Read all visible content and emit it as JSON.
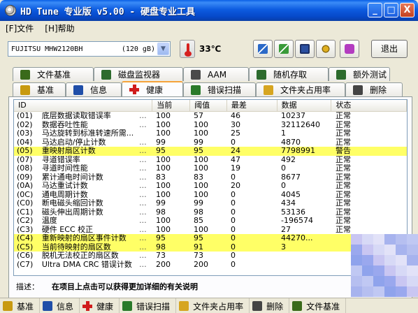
{
  "window": {
    "title": "HD Tune 专业版 v5.00 - 硬盘专业工具",
    "buttons": [
      "_",
      "□",
      "X"
    ]
  },
  "menu": [
    "[F]文件",
    "[H]帮助"
  ],
  "toolbar": {
    "drive_name": "FUJITSU MHW2120BH",
    "drive_size": "(120 gB)",
    "temperature": "33℃",
    "exit_label": "退出"
  },
  "tabs_top": [
    {
      "label": "文件基准",
      "icon": "file-benchmark-icon",
      "color": "#3a6a1a"
    },
    {
      "label": "磁盘监视器",
      "icon": "disk-monitor-icon",
      "color": "#2d6b2d"
    },
    {
      "label": "AAM",
      "icon": "speaker-icon",
      "color": "#4a4a4a"
    },
    {
      "label": "随机存取",
      "icon": "random-access-icon",
      "color": "#2d6b2d"
    },
    {
      "label": "额外测试",
      "icon": "extra-tests-icon",
      "color": "#2d6b2d"
    }
  ],
  "tabs_bottom": [
    {
      "label": "基准",
      "icon": "benchmark-icon",
      "color": "#c89a10"
    },
    {
      "label": "信息",
      "icon": "info-icon",
      "color": "#1f4ea8"
    },
    {
      "label": "健康",
      "icon": "health-cross-icon",
      "color": "#d01c1c"
    },
    {
      "label": "错误扫描",
      "icon": "error-scan-icon",
      "color": "#2a7a2a"
    },
    {
      "label": "文件夹占用率",
      "icon": "folder-usage-icon",
      "color": "#d6a520"
    },
    {
      "label": "删除",
      "icon": "erase-icon",
      "color": "#444444"
    }
  ],
  "active_tab": "健康",
  "table": {
    "columns": [
      "ID",
      "当前",
      "阈值",
      "最差",
      "数据",
      "状态"
    ],
    "rows": [
      {
        "id": "(01)",
        "name": "底层数据读取错误率",
        "dots": "...",
        "cur": "100",
        "th": "57",
        "worst": "46",
        "data": "10237",
        "status": "正常",
        "warn": false
      },
      {
        "id": "(02)",
        "name": "数据吞吐性能",
        "dots": "...",
        "cur": "100",
        "th": "100",
        "worst": "30",
        "data": "32112640",
        "status": "正常",
        "warn": false
      },
      {
        "id": "(03)",
        "name": "马达旋转到标准转速所需...",
        "dots": "",
        "cur": "100",
        "th": "100",
        "worst": "25",
        "data": "1",
        "status": "正常",
        "warn": false
      },
      {
        "id": "(04)",
        "name": "马达启动/停止计数",
        "dots": "...",
        "cur": "99",
        "th": "99",
        "worst": "0",
        "data": "4870",
        "status": "正常",
        "warn": false
      },
      {
        "id": "(05)",
        "name": "重映射扇区计数",
        "dots": "...",
        "cur": "95",
        "th": "95",
        "worst": "24",
        "data": "7798991",
        "status": "警告",
        "warn": true
      },
      {
        "id": "(07)",
        "name": "寻道错误率",
        "dots": "...",
        "cur": "100",
        "th": "100",
        "worst": "47",
        "data": "492",
        "status": "正常",
        "warn": false
      },
      {
        "id": "(08)",
        "name": "寻道时间性能",
        "dots": "...",
        "cur": "100",
        "th": "100",
        "worst": "19",
        "data": "0",
        "status": "正常",
        "warn": false
      },
      {
        "id": "(09)",
        "name": "累计通电时间计数",
        "dots": "...",
        "cur": "83",
        "th": "83",
        "worst": "0",
        "data": "8677",
        "status": "正常",
        "warn": false
      },
      {
        "id": "(0A)",
        "name": "马达重试计数",
        "dots": "...",
        "cur": "100",
        "th": "100",
        "worst": "20",
        "data": "0",
        "status": "正常",
        "warn": false
      },
      {
        "id": "(0C)",
        "name": "通电周期计数",
        "dots": "...",
        "cur": "100",
        "th": "100",
        "worst": "0",
        "data": "4045",
        "status": "正常",
        "warn": false
      },
      {
        "id": "(C0)",
        "name": "断电磁头缩回计数",
        "dots": "...",
        "cur": "99",
        "th": "99",
        "worst": "0",
        "data": "434",
        "status": "正常",
        "warn": false
      },
      {
        "id": "(C1)",
        "name": "磁头伸出周期计数",
        "dots": "...",
        "cur": "98",
        "th": "98",
        "worst": "0",
        "data": "53136",
        "status": "正常",
        "warn": false
      },
      {
        "id": "(C2)",
        "name": "温度",
        "dots": "...",
        "cur": "100",
        "th": "85",
        "worst": "0",
        "data": "-196574",
        "status": "正常",
        "warn": false
      },
      {
        "id": "(C3)",
        "name": "硬件 ECC 校正",
        "dots": "...",
        "cur": "100",
        "th": "100",
        "worst": "0",
        "data": "27",
        "status": "正常",
        "warn": false
      },
      {
        "id": "(C4)",
        "name": "重新映射的扇区事件计数",
        "dots": "...",
        "cur": "95",
        "th": "95",
        "worst": "0",
        "data": "44270...",
        "status": "",
        "warn": true
      },
      {
        "id": "(C5)",
        "name": "当前待映射的扇区数",
        "dots": "...",
        "cur": "98",
        "th": "91",
        "worst": "0",
        "data": "3",
        "status": "",
        "warn": true
      },
      {
        "id": "(C6)",
        "name": "脱机无法校正的扇区数",
        "dots": "...",
        "cur": "73",
        "th": "73",
        "worst": "0",
        "data": "",
        "status": "",
        "warn": false
      },
      {
        "id": "(C7)",
        "name": "Ultra DMA CRC 错误计数",
        "dots": "...",
        "cur": "200",
        "th": "200",
        "worst": "0",
        "data": "",
        "status": "",
        "warn": false
      }
    ]
  },
  "description": {
    "label": "描述：",
    "text": "在项目上点击可以获得更加详细的有关说明"
  },
  "taskbar": [
    {
      "label": "基准",
      "icon": "benchmark-icon",
      "color": "#c89a10"
    },
    {
      "label": "信息",
      "icon": "info-icon",
      "color": "#1f4ea8"
    },
    {
      "label": "健康",
      "icon": "health-cross-icon",
      "color": "#d01c1c"
    },
    {
      "label": "错误扫描",
      "icon": "error-scan-icon",
      "color": "#2a7a2a"
    },
    {
      "label": "文件夹占用率",
      "icon": "folder-usage-icon",
      "color": "#d6a520"
    },
    {
      "label": "删除",
      "icon": "erase-icon",
      "color": "#444444"
    },
    {
      "label": "文件基准",
      "icon": "file-benchmark-icon",
      "color": "#3a6a1a"
    }
  ],
  "colors": {
    "warning_highlight": "#ffff66",
    "titlebar": "#0a5fe6"
  }
}
